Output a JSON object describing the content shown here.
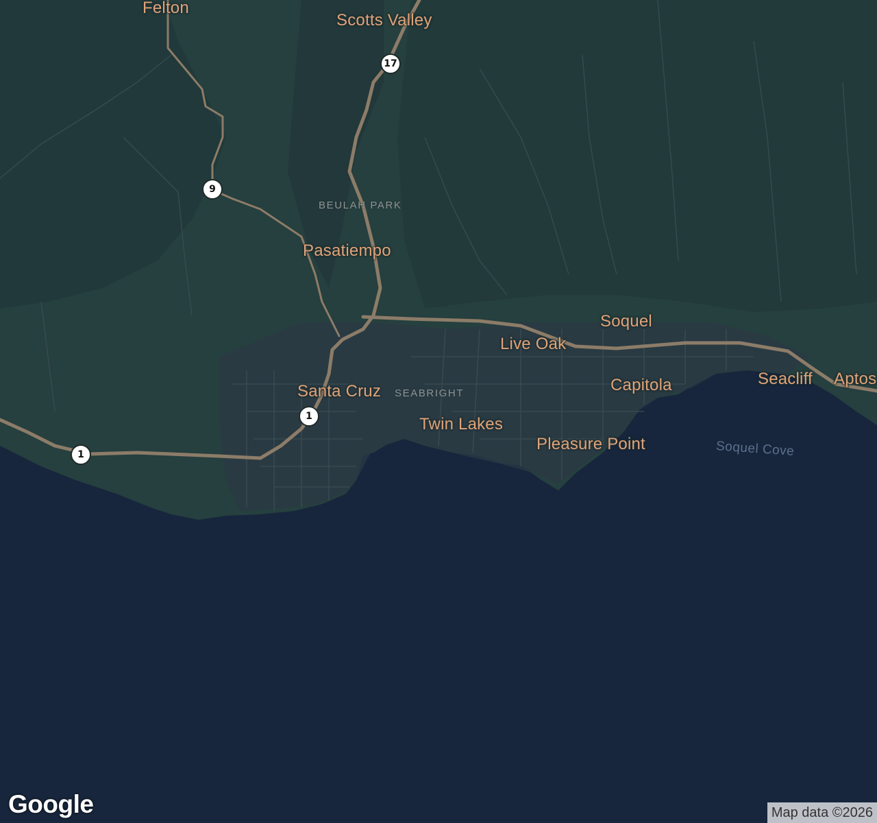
{
  "map": {
    "colors": {
      "water": "#17263c",
      "land": "#263f3f",
      "land_dark": "#21393a",
      "urban": "#2b3a46",
      "road_minor": "#3b4d52",
      "highway": "#8c7c68",
      "place_label": "#e0a37a",
      "neighborhood_label": "#8f9491",
      "water_label": "#5c6f8c"
    },
    "places": [
      {
        "name": "Felton"
      },
      {
        "name": "Scotts Valley"
      },
      {
        "name": "Pasatiempo"
      },
      {
        "name": "Soquel"
      },
      {
        "name": "Live Oak"
      },
      {
        "name": "Santa Cruz"
      },
      {
        "name": "Capitola"
      },
      {
        "name": "Seacliff"
      },
      {
        "name": "Aptos"
      },
      {
        "name": "Twin Lakes"
      },
      {
        "name": "Pleasure Point"
      }
    ],
    "neighborhoods": [
      {
        "name": "BEULAH PARK"
      },
      {
        "name": "SEABRIGHT"
      }
    ],
    "water_features": [
      {
        "name": "Soquel Cove"
      }
    ],
    "route_shields": [
      {
        "number": "17"
      },
      {
        "number": "9"
      },
      {
        "number": "1"
      },
      {
        "number": "1"
      }
    ],
    "logo": "Google",
    "attribution": "Map data ©2026"
  }
}
